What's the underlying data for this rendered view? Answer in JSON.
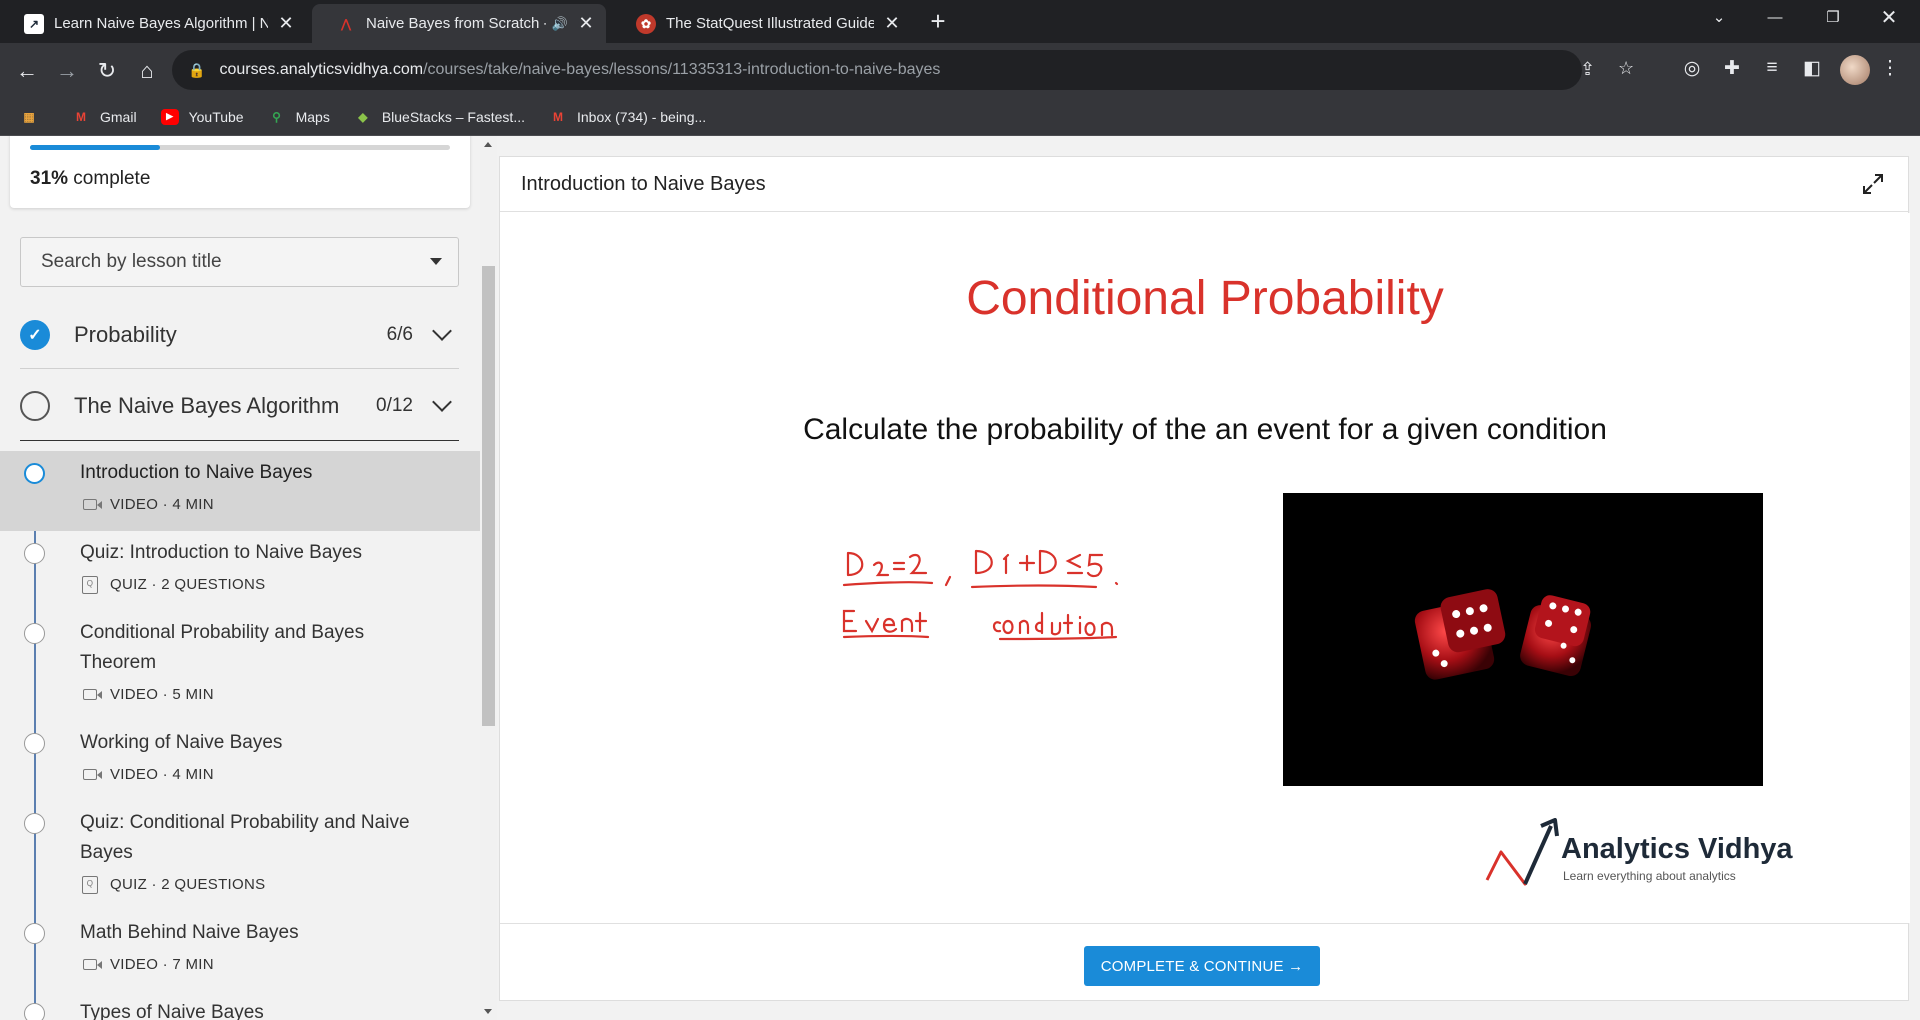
{
  "browser": {
    "tabs": [
      {
        "title": "Learn Naive Bayes Algorithm | N",
        "active": false
      },
      {
        "title": "Naive Bayes from Scratch - A",
        "active": true,
        "audio": "🔊"
      },
      {
        "title": "The StatQuest Illustrated Guide t",
        "active": false
      }
    ],
    "url_host": "courses.analyticsvidhya.com",
    "url_path": "/courses/take/naive-bayes/lessons/11335313-introduction-to-naive-bayes",
    "bookmarks": [
      {
        "label": "",
        "icon": "apps-icon"
      },
      {
        "label": "Gmail",
        "icon": "gmail-icon"
      },
      {
        "label": "YouTube",
        "icon": "youtube-icon"
      },
      {
        "label": "Maps",
        "icon": "maps-icon"
      },
      {
        "label": "BlueStacks – Fastest...",
        "icon": "bluestacks-icon"
      },
      {
        "label": "Inbox (734) - being...",
        "icon": "gmail-icon"
      }
    ]
  },
  "sidebar": {
    "progress_percent": 31,
    "progress_value": "31%",
    "progress_suffix": " complete",
    "search_placeholder": "Search by lesson title",
    "sections": [
      {
        "title": "Probability",
        "count": "6/6",
        "done": true
      },
      {
        "title": "The Naive Bayes Algorithm",
        "count": "0/12",
        "done": false
      }
    ],
    "lessons": [
      {
        "title": "Introduction to Naive Bayes",
        "meta": "VIDEO · 4 MIN",
        "type": "video",
        "active": true
      },
      {
        "title": "Quiz: Introduction to Naive Bayes",
        "meta": "QUIZ · 2 QUESTIONS",
        "type": "quiz",
        "active": false
      },
      {
        "title": "Conditional Probability and Bayes Theorem",
        "meta": "VIDEO · 5 MIN",
        "type": "video",
        "active": false
      },
      {
        "title": "Working of Naive Bayes",
        "meta": "VIDEO · 4 MIN",
        "type": "video",
        "active": false
      },
      {
        "title": "Quiz: Conditional Probability and Naive Bayes",
        "meta": "QUIZ · 2 QUESTIONS",
        "type": "quiz",
        "active": false
      },
      {
        "title": "Math Behind Naive Bayes",
        "meta": "VIDEO · 7 MIN",
        "type": "video",
        "active": false
      },
      {
        "title": "Types of Naive Bayes",
        "meta": "",
        "type": "video",
        "active": false
      }
    ]
  },
  "main": {
    "header_title": "Introduction to Naive Bayes",
    "slide": {
      "title": "Conditional Probability",
      "subtitle": "Calculate the probability of the an event for a given condition",
      "logo_name": "Analytics Vidhya",
      "logo_tagline": "Learn everything about analytics"
    },
    "cta_label": "COMPLETE & CONTINUE →"
  },
  "colors": {
    "accent": "#1a8bd8",
    "slide_title": "#d9322b",
    "handwriting": "#d9322b"
  }
}
